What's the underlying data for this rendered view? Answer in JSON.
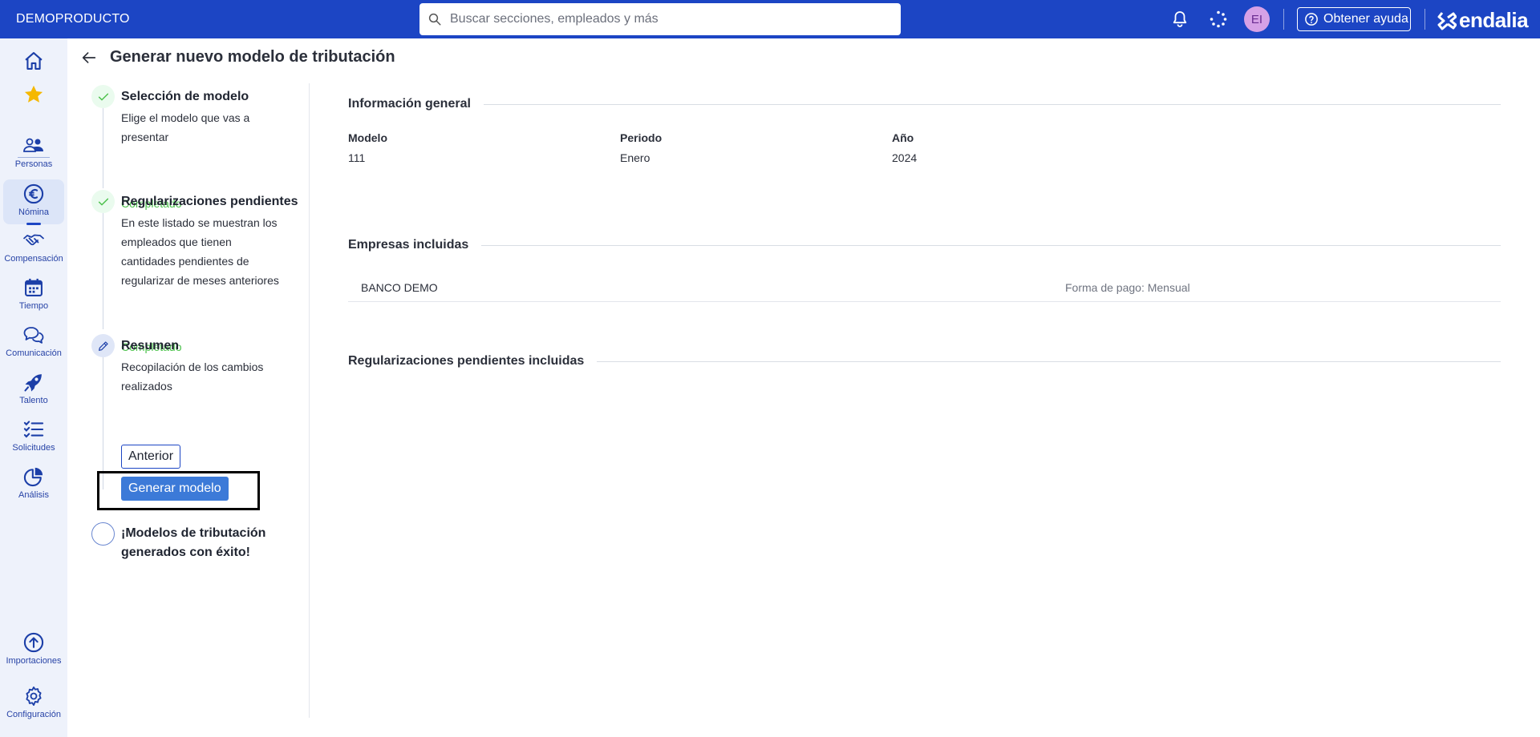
{
  "topbar": {
    "brand": "DEMOPRODUCTO",
    "search_placeholder": "Buscar secciones, empleados y más",
    "avatar_initials": "EI",
    "help_label": "Obtener ayuda",
    "logo_text": "endalia"
  },
  "sidebar": {
    "items": [
      {
        "label": "",
        "icon": "home-icon"
      },
      {
        "label": "",
        "icon": "star-icon"
      },
      {
        "label": "Personas",
        "icon": "people-icon"
      },
      {
        "label": "Nómina",
        "icon": "euro-icon"
      },
      {
        "label": "Compensación",
        "icon": "handshake-icon"
      },
      {
        "label": "Tiempo",
        "icon": "calendar-icon"
      },
      {
        "label": "Comunicación",
        "icon": "chat-icon"
      },
      {
        "label": "Talento",
        "icon": "rocket-icon"
      },
      {
        "label": "Solicitudes",
        "icon": "checklist-icon"
      },
      {
        "label": "Análisis",
        "icon": "pie-chart-icon"
      },
      {
        "label": "Importaciones",
        "icon": "upload-icon"
      },
      {
        "label": "Configuración",
        "icon": "gear-icon"
      }
    ],
    "active": "Nómina"
  },
  "page": {
    "title": "Generar nuevo modelo de tributación"
  },
  "stepper": {
    "steps": [
      {
        "title": "Selección de modelo",
        "description": "Elige el modelo que vas a presentar",
        "status": "Completado"
      },
      {
        "title": "Regularizaciones pendientes",
        "description": "En este listado se muestran los empleados que tienen cantidades pendientes de regularizar de meses anteriores",
        "status": "Completado"
      },
      {
        "title": "Resumen",
        "description": "Recopilación de los cambios realizados",
        "status": ""
      },
      {
        "title": "¡Modelos de tributación generados con éxito!",
        "description": "",
        "status": ""
      }
    ],
    "prev_label": "Anterior",
    "generate_label": "Generar modelo"
  },
  "summary": {
    "general_title": "Información general",
    "fields": [
      {
        "label": "Modelo",
        "value": "111"
      },
      {
        "label": "Periodo",
        "value": "Enero"
      },
      {
        "label": "Año",
        "value": "2024"
      }
    ],
    "companies_title": "Empresas incluidas",
    "companies": [
      {
        "name": "BANCO DEMO",
        "payment": "Forma de pago: Mensual"
      }
    ],
    "regularizations_title": "Regularizaciones pendientes incluidas"
  },
  "colors": {
    "brand_blue": "#1c45c4",
    "completed_green": "#4cc14c",
    "primary_button": "#3c7ad8"
  }
}
